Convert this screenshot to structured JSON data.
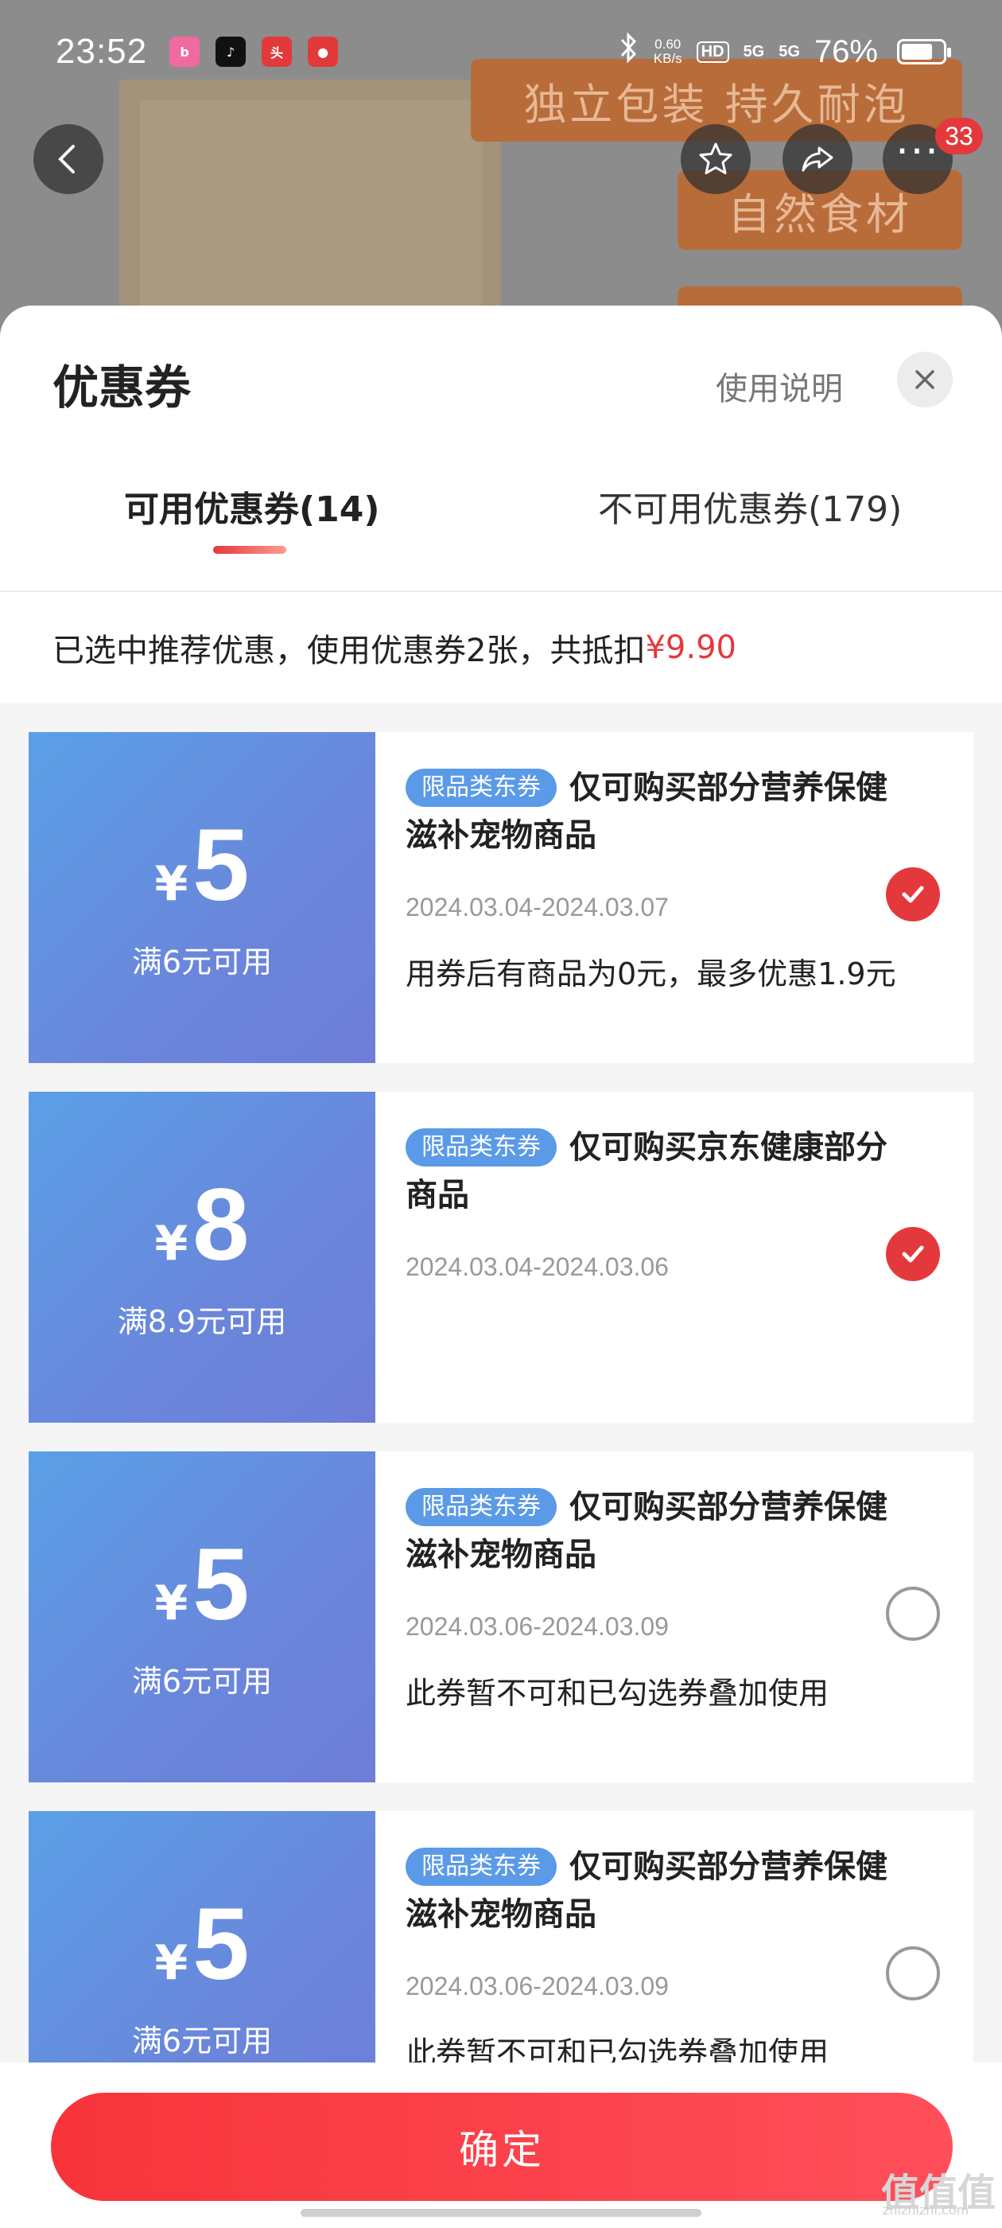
{
  "status_bar": {
    "time": "23:52",
    "net_speed_value": "0.60",
    "net_speed_unit": "KB/s",
    "hd": "HD",
    "signal1": "5G",
    "signal2": "5G",
    "battery": "76%",
    "apps": [
      "bilibili",
      "tiktok",
      "头条",
      "app"
    ]
  },
  "background": {
    "banner1": "独立包装 持久耐泡",
    "banner2": "自然食材",
    "badge_count": "33"
  },
  "sheet": {
    "title": "优惠券",
    "usage_link": "使用说明",
    "tabs": [
      {
        "label": "可用优惠券(14)"
      },
      {
        "label": "不可用优惠券(179)"
      }
    ],
    "summary_text": "已选中推荐优惠，使用优惠券2张，共抵扣",
    "summary_amount": "¥9.90"
  },
  "coupons": [
    {
      "yen": "¥",
      "amount": "5",
      "condition": "满6元可用",
      "tag": "限品类东券",
      "title": "仅可购买部分营养保健滋补宠物商品",
      "date": "2024.03.04-2024.03.07",
      "note": "用券后有商品为0元，最多优惠1.9元",
      "selected": true
    },
    {
      "yen": "¥",
      "amount": "8",
      "condition": "满8.9元可用",
      "tag": "限品类东券",
      "title": "仅可购买京东健康部分商品",
      "date": "2024.03.04-2024.03.06",
      "note": "",
      "selected": true
    },
    {
      "yen": "¥",
      "amount": "5",
      "condition": "满6元可用",
      "tag": "限品类东券",
      "title": "仅可购买部分营养保健滋补宠物商品",
      "date": "2024.03.06-2024.03.09",
      "note": "此券暂不可和已勾选券叠加使用",
      "selected": false
    },
    {
      "yen": "¥",
      "amount": "5",
      "condition": "满6元可用",
      "tag": "限品类东券",
      "title": "仅可购买部分营养保健滋补宠物商品",
      "date": "2024.03.06-2024.03.09",
      "note": "此券暂不可和已勾选券叠加使用",
      "selected": false
    }
  ],
  "footer": {
    "confirm_label": "确定"
  },
  "watermark": {
    "text": "值值值",
    "sub": "zhizhizhi.com"
  },
  "colors": {
    "accent": "#e4393c",
    "coupon_blue": "#5aa0e6",
    "tag_blue": "#5b9ae6"
  }
}
